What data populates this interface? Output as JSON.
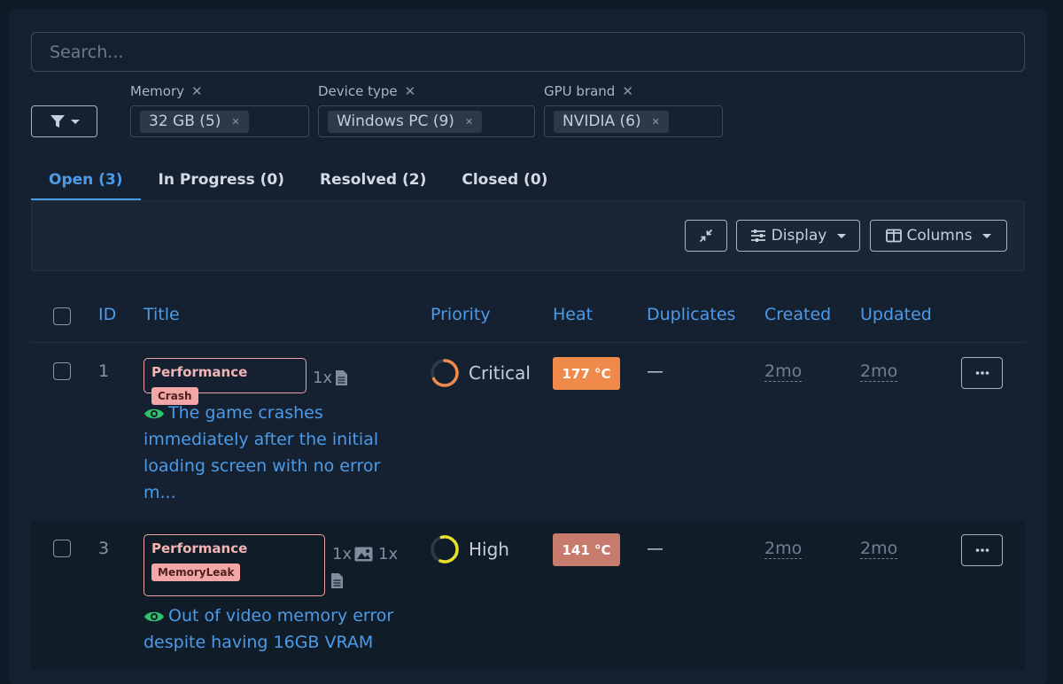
{
  "search": {
    "placeholder": "Search..."
  },
  "filters": {
    "button_icon": "filter-icon",
    "facets": [
      {
        "label": "Memory",
        "chip": "32 GB (5)"
      },
      {
        "label": "Device type",
        "chip": "Windows PC (9)"
      },
      {
        "label": "GPU brand",
        "chip": "NVIDIA (6)"
      }
    ]
  },
  "tabs": [
    {
      "label": "Open (3)",
      "active": true
    },
    {
      "label": "In Progress (0)",
      "active": false
    },
    {
      "label": "Resolved (2)",
      "active": false
    },
    {
      "label": "Closed (0)",
      "active": false
    }
  ],
  "toolbar": {
    "collapse_icon": "compress-icon",
    "display_label": "Display",
    "columns_label": "Columns"
  },
  "table": {
    "columns": [
      "ID",
      "Title",
      "Priority",
      "Heat",
      "Duplicates",
      "Created",
      "Updated"
    ],
    "rows": [
      {
        "id": "1",
        "category": "Performance",
        "badge": "Crash",
        "attachments": [
          {
            "count": "1x",
            "icon": "document-icon"
          }
        ],
        "description": "The game crashes immediately after the initial loading screen with no error m...",
        "priority": "Critical",
        "priority_color": "#f08a4b",
        "priority_level": 0.85,
        "heat": "177 °C",
        "heat_color": "#f08a4b",
        "duplicates": "—",
        "created": "2mo",
        "updated": "2mo"
      },
      {
        "id": "3",
        "category": "Performance",
        "badge": "MemoryLeak",
        "attachments": [
          {
            "count": "1x",
            "icon": "image-icon"
          },
          {
            "count": "1x",
            "icon": "document-icon"
          }
        ],
        "description": "Out of video memory error despite having 16GB VRAM",
        "priority": "High",
        "priority_color": "#e8e02c",
        "priority_level": 0.6,
        "heat": "141 °C",
        "heat_color": "#c77b6d",
        "duplicates": "—",
        "created": "2mo",
        "updated": "2mo"
      }
    ]
  },
  "colors": {
    "background": "#0f1a27",
    "accent": "#4c9be8",
    "eye_icon": "#2fc46b"
  }
}
